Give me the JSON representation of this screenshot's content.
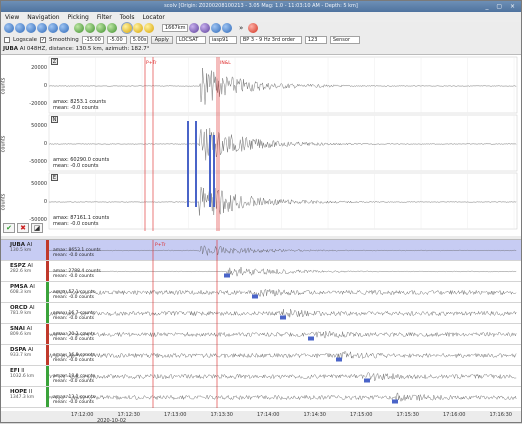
{
  "window": {
    "title": "scolv [Origin: Z0200208100213 - 3.05 Mag: 1.0 - 11:03:10 AM - Depth: 5 km]",
    "controls": "_ ▢ ×"
  },
  "menu": [
    "View",
    "Navigation",
    "Picking",
    "Filter",
    "Tools",
    "Locator"
  ],
  "toolbar": {
    "buttons": [
      {
        "name": "zoom-in-icon",
        "color": "blue"
      },
      {
        "name": "zoom-out-icon",
        "color": "blue"
      },
      {
        "name": "scale-up-icon",
        "color": "blue"
      },
      {
        "name": "scale-down-icon",
        "color": "blue"
      },
      {
        "name": "prev-trace-icon",
        "color": "blue"
      },
      {
        "name": "next-trace-icon",
        "color": "blue"
      },
      {
        "name": "align-p-icon",
        "color": "green"
      },
      {
        "name": "align-s-icon",
        "color": "green"
      },
      {
        "name": "sort-distance-icon",
        "color": "green"
      },
      {
        "name": "sort-residual-icon",
        "color": "green"
      },
      {
        "name": "pick-p-icon",
        "color": "yellow"
      },
      {
        "name": "pick-s-icon",
        "color": "yellow"
      },
      {
        "name": "pick-other-icon",
        "color": "yellow"
      }
    ],
    "distance_value": "1667km",
    "buttons2": [
      {
        "name": "component-z-icon",
        "color": "purple"
      },
      {
        "name": "component-n-icon",
        "color": "purple"
      },
      {
        "name": "component-e-icon",
        "color": "blue"
      },
      {
        "name": "component-all-icon",
        "color": "blue"
      }
    ],
    "more_label": "»",
    "stop_icon": "stop-icon"
  },
  "options": {
    "logscale_label": "Logscale",
    "smoothing_label": "Smoothing",
    "smoothing_checked": true,
    "pre_value": "-15.00",
    "post_value": "-5.00",
    "width_value": "5.00s",
    "apply_label": "Apply",
    "locator": "LOCSAT",
    "profile": "iasp91",
    "filter": "BP 3 - 9 Hz 3rd order",
    "max_value": "123",
    "sensor": "Sensor"
  },
  "info": {
    "station": "JUBA",
    "details": "AI  048HZ, distance: 130.5 km, azimuth: 182.7°"
  },
  "upper": {
    "ylabel": "counts",
    "panels": [
      {
        "box": "Z",
        "ticks": [
          "20000",
          "0",
          "-20000"
        ],
        "amax": "amax: 8253.1 counts",
        "mean": "mean: -0.0 counts"
      },
      {
        "box": "N",
        "ticks": [
          "50000",
          "0",
          "-50000"
        ],
        "amax": "amax: 60290.0 counts",
        "mean": "mean: -0.0 counts"
      },
      {
        "box": "E",
        "ticks": [
          "50000",
          "0",
          "-50000"
        ],
        "amax": "amax: 87161.1 counts",
        "mean": "mean: -0.0 counts"
      }
    ],
    "pick_labels": [
      "P+Tr",
      "IN&L"
    ],
    "time_ticks": [
      "17:12:00",
      "17:12:30",
      "17:13:00",
      "17:13:30",
      "17:14:00",
      "17:14:30",
      "17:15:00",
      "17:15:30",
      "17:16:00",
      "17:16:30"
    ],
    "date": "2020-10-02"
  },
  "lower": {
    "rows": [
      {
        "sta": "JUBA",
        "net": "AI",
        "dist": "130.5 km",
        "status": "#c0392b",
        "amax": "amax: 8653.1 counts",
        "mean": "mean: -0.0 counts",
        "hl": true
      },
      {
        "sta": "ESPZ",
        "net": "AI",
        "dist": "282.6 km",
        "status": "#c0392b",
        "amax": "amax: 2788.4 counts",
        "mean": "mean: -0.0 counts",
        "hl": false
      },
      {
        "sta": "PMSA",
        "net": "AI",
        "dist": "608.3 km",
        "status": "#3aa33a",
        "amax": "amax: 57.1 counts",
        "mean": "mean: -0.0 counts",
        "hl": false
      },
      {
        "sta": "ORCD",
        "net": "AI",
        "dist": "781.9 km",
        "status": "#3aa33a",
        "amax": "amax: 16.7 counts",
        "mean": "mean: -0.0 counts",
        "hl": false
      },
      {
        "sta": "SNAI",
        "net": "AI",
        "dist": "809.6 km",
        "status": "#c0392b",
        "amax": "amax: 20.2 counts",
        "mean": "mean: -0.0 counts",
        "hl": false
      },
      {
        "sta": "DSPA",
        "net": "AI",
        "dist": "933.7 km",
        "status": "#c0392b",
        "amax": "amax: 16.8 counts",
        "mean": "mean: -0.0 counts",
        "hl": false
      },
      {
        "sta": "EFI",
        "net": "II",
        "dist": "1032.6 km",
        "status": "#3aa33a",
        "amax": "amax: 18.0 counts",
        "mean": "mean: -0.0 counts",
        "hl": false
      },
      {
        "sta": "HOPE",
        "net": "II",
        "dist": "1347.3 km",
        "status": "#3aa33a",
        "amax": "amax: 13.1 counts",
        "mean": "mean: -0.0 counts",
        "hl": false
      }
    ],
    "pick_label": "P+Tr",
    "time_ticks": [
      "17:12:00",
      "17:12:30",
      "17:13:00",
      "17:13:30",
      "17:14:00",
      "17:14:30",
      "17:15:00",
      "17:15:30",
      "17:16:00",
      "17:16:30"
    ],
    "date": "2020-10-02"
  },
  "actions": [
    "accept-icon",
    "reject-icon",
    "tag-icon"
  ]
}
